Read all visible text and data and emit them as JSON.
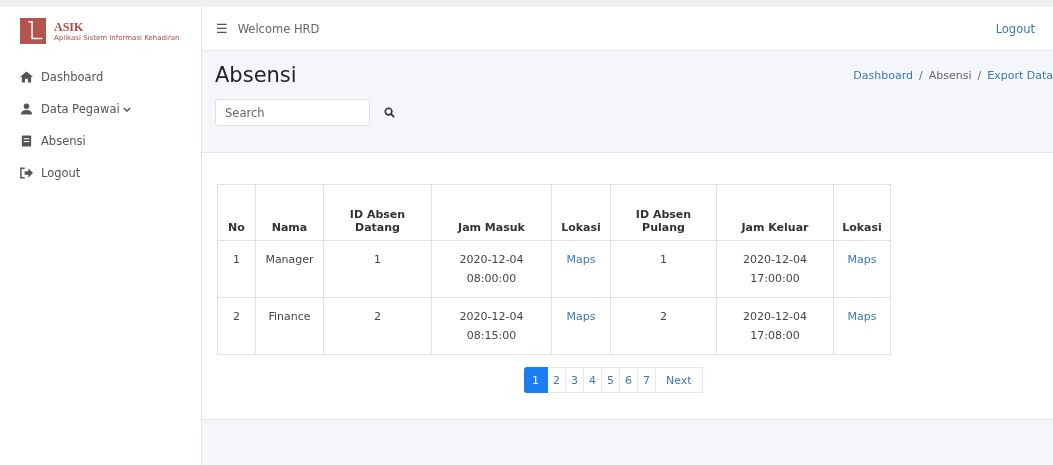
{
  "brand": {
    "title": "ASIK",
    "subtitle": "Aplikasi Sistem Informasi Kehadiran"
  },
  "sidebar": {
    "items": [
      {
        "label": "Dashboard",
        "expandable": false
      },
      {
        "label": "Data Pegawai",
        "expandable": true
      },
      {
        "label": "Absensi",
        "expandable": false
      },
      {
        "label": "Logout",
        "expandable": false
      }
    ]
  },
  "topbar": {
    "menu_icon": "☰",
    "welcome": "Welcome HRD",
    "logout": "Logout"
  },
  "page": {
    "title": "Absensi",
    "breadcrumb": [
      {
        "label": "Dashboard",
        "link": true
      },
      {
        "label": "Absensi",
        "link": false
      },
      {
        "label": "Export Data",
        "link": true
      }
    ],
    "breadcrumb_separator": "/"
  },
  "search": {
    "placeholder": "Search"
  },
  "table": {
    "columns": [
      "No",
      "Nama",
      "ID Absen Datang",
      "Jam Masuk",
      "Lokasi",
      "ID Absen Pulang",
      "Jam Keluar",
      "Lokasi"
    ],
    "rows": [
      [
        "1",
        "Manager",
        "1",
        "2020-12-04 08:00:00",
        "Maps",
        "1",
        "2020-12-04 17:00:00",
        "Maps"
      ],
      [
        "2",
        "Finance",
        "2",
        "2020-12-04 08:15:00",
        "Maps",
        "2",
        "2020-12-04 17:08:00",
        "Maps"
      ]
    ]
  },
  "pagination": {
    "pages": [
      {
        "label": "1",
        "selected": true
      },
      {
        "label": "2",
        "selected": false
      },
      {
        "label": "3",
        "selected": false
      },
      {
        "label": "4",
        "selected": false
      },
      {
        "label": "5",
        "selected": false
      },
      {
        "label": "6",
        "selected": false
      },
      {
        "label": "7",
        "selected": false
      }
    ],
    "next": "Next"
  }
}
